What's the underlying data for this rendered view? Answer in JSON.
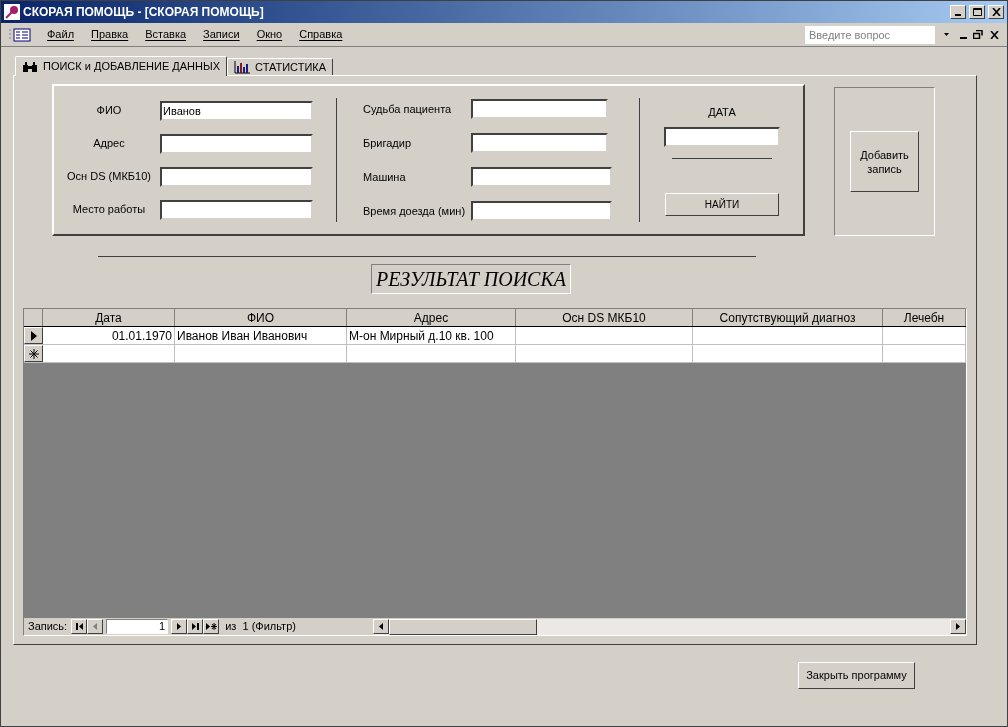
{
  "window": {
    "title": "СКОРАЯ ПОМОЩЬ - [СКОРАЯ ПОМОЩЬ]"
  },
  "menu": [
    "Файл",
    "Правка",
    "Вставка",
    "Записи",
    "Окно",
    "Справка"
  ],
  "help_box": {
    "placeholder": "Введите вопрос"
  },
  "tabs": [
    {
      "label": "ПОИСК и ДОБАВЛЕНИЕ ДАННЫХ",
      "selected": true,
      "kind": "binoculars"
    },
    {
      "label": "СТАТИСТИКА",
      "selected": false,
      "kind": "chart"
    }
  ],
  "search_form": {
    "left_fields": [
      {
        "label": "ФИО",
        "value": "Иванов"
      },
      {
        "label": "Адрес"
      },
      {
        "label": "Осн DS (МКБ10)"
      },
      {
        "label": "Место работы"
      }
    ],
    "right_fields": [
      {
        "label": "Судьба пациента"
      },
      {
        "label": "Бригадир"
      },
      {
        "label": "Машина"
      },
      {
        "label": "Время доезда (мин)"
      }
    ],
    "date_label": "ДАТА",
    "find_button": "НАЙТИ"
  },
  "add_button": "Добавить запись",
  "results_title": "РЕЗУЛЬТАТ ПОИСКА",
  "table": {
    "columns": [
      "Дата",
      "ФИО",
      "Адрес",
      "Осн DS МКБ10",
      "Сопутствующий диагноз",
      "Лечебн"
    ],
    "rows": [
      {
        "kind": "current",
        "cells": [
          "01.01.1970",
          "Иванов Иван Иванович",
          "М-он Мирный д.10 кв. 100",
          null,
          null,
          null
        ]
      },
      {
        "kind": "new",
        "cells": [
          null,
          null,
          null,
          null,
          null,
          null
        ]
      }
    ]
  },
  "navigator": {
    "label": "Запись:",
    "current": "1",
    "total": "из  1 (Фильтр)"
  },
  "close_button": "Закрыть программу"
}
